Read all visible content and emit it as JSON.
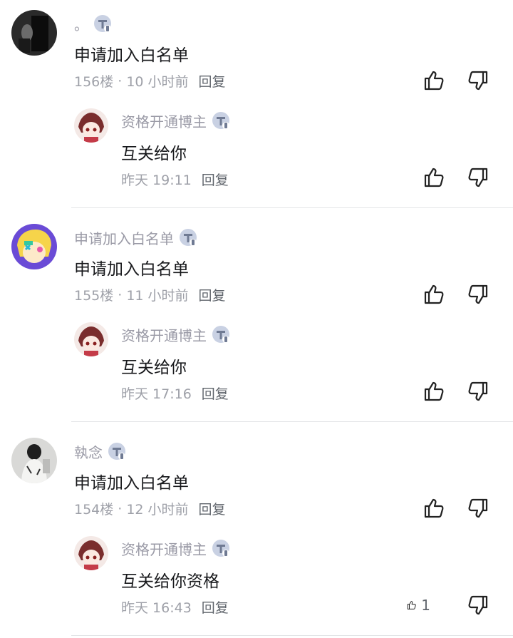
{
  "icons": {
    "badge": "badge-icon",
    "like": "thumbs-up-icon",
    "dislike": "thumbs-down-icon"
  },
  "comments": [
    {
      "username": "。",
      "text": "申请加入白名单",
      "floor": "156楼",
      "separator": "·",
      "time": "10 小时前",
      "reply_label": "回复",
      "reply": {
        "username": "资格开通博主",
        "text": "互关给你",
        "time": "昨天 19:11",
        "reply_label": "回复",
        "like_count": ""
      }
    },
    {
      "username": "申请加入白名单",
      "text": "申请加入白名单",
      "floor": "155楼",
      "separator": "·",
      "time": "11 小时前",
      "reply_label": "回复",
      "reply": {
        "username": "资格开通博主",
        "text": "互关给你",
        "time": "昨天 17:16",
        "reply_label": "回复",
        "like_count": ""
      }
    },
    {
      "username": "執念",
      "text": "申请加入白名单",
      "floor": "154楼",
      "separator": "·",
      "time": "12 小时前",
      "reply_label": "回复",
      "reply": {
        "username": "资格开通博主",
        "text": "互关给你资格",
        "time": "昨天 16:43",
        "reply_label": "回复",
        "like_count": "1"
      }
    }
  ]
}
